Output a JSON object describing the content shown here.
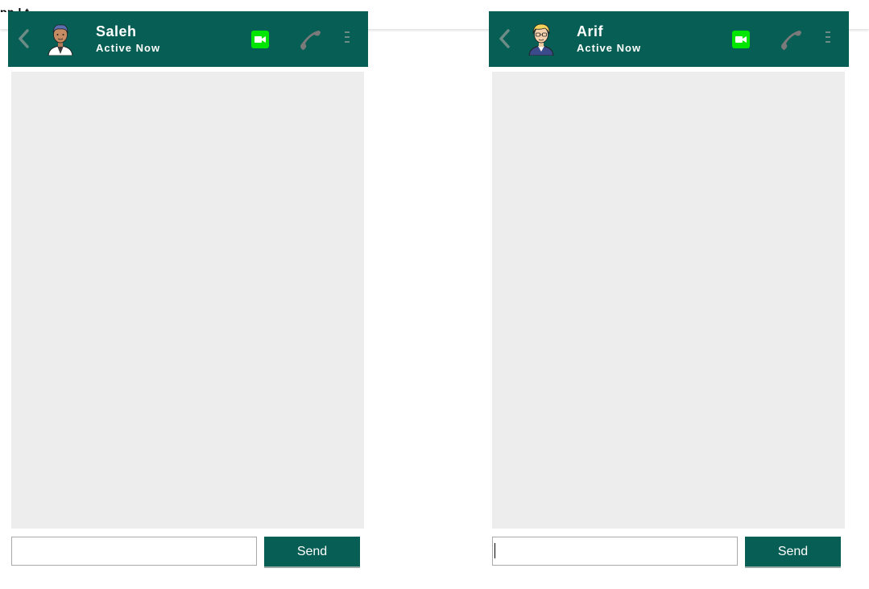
{
  "top_bar": {
    "clipped_text": "pp   l  t"
  },
  "colors": {
    "header_bg": "#075e54",
    "messages_bg": "#ededed",
    "video_icon": "#00e600",
    "phone_icon": "#7a7a7a"
  },
  "chats": [
    {
      "contact_name": "Saleh",
      "status": "Active Now",
      "avatar_icon": "male-avatar-icon",
      "input": {
        "value": "",
        "placeholder": ""
      },
      "send_label": "Send"
    },
    {
      "contact_name": "Arif",
      "status": "Active Now",
      "avatar_icon": "blonde-avatar-icon",
      "input": {
        "value": "",
        "placeholder": ""
      },
      "send_label": "Send"
    }
  ]
}
